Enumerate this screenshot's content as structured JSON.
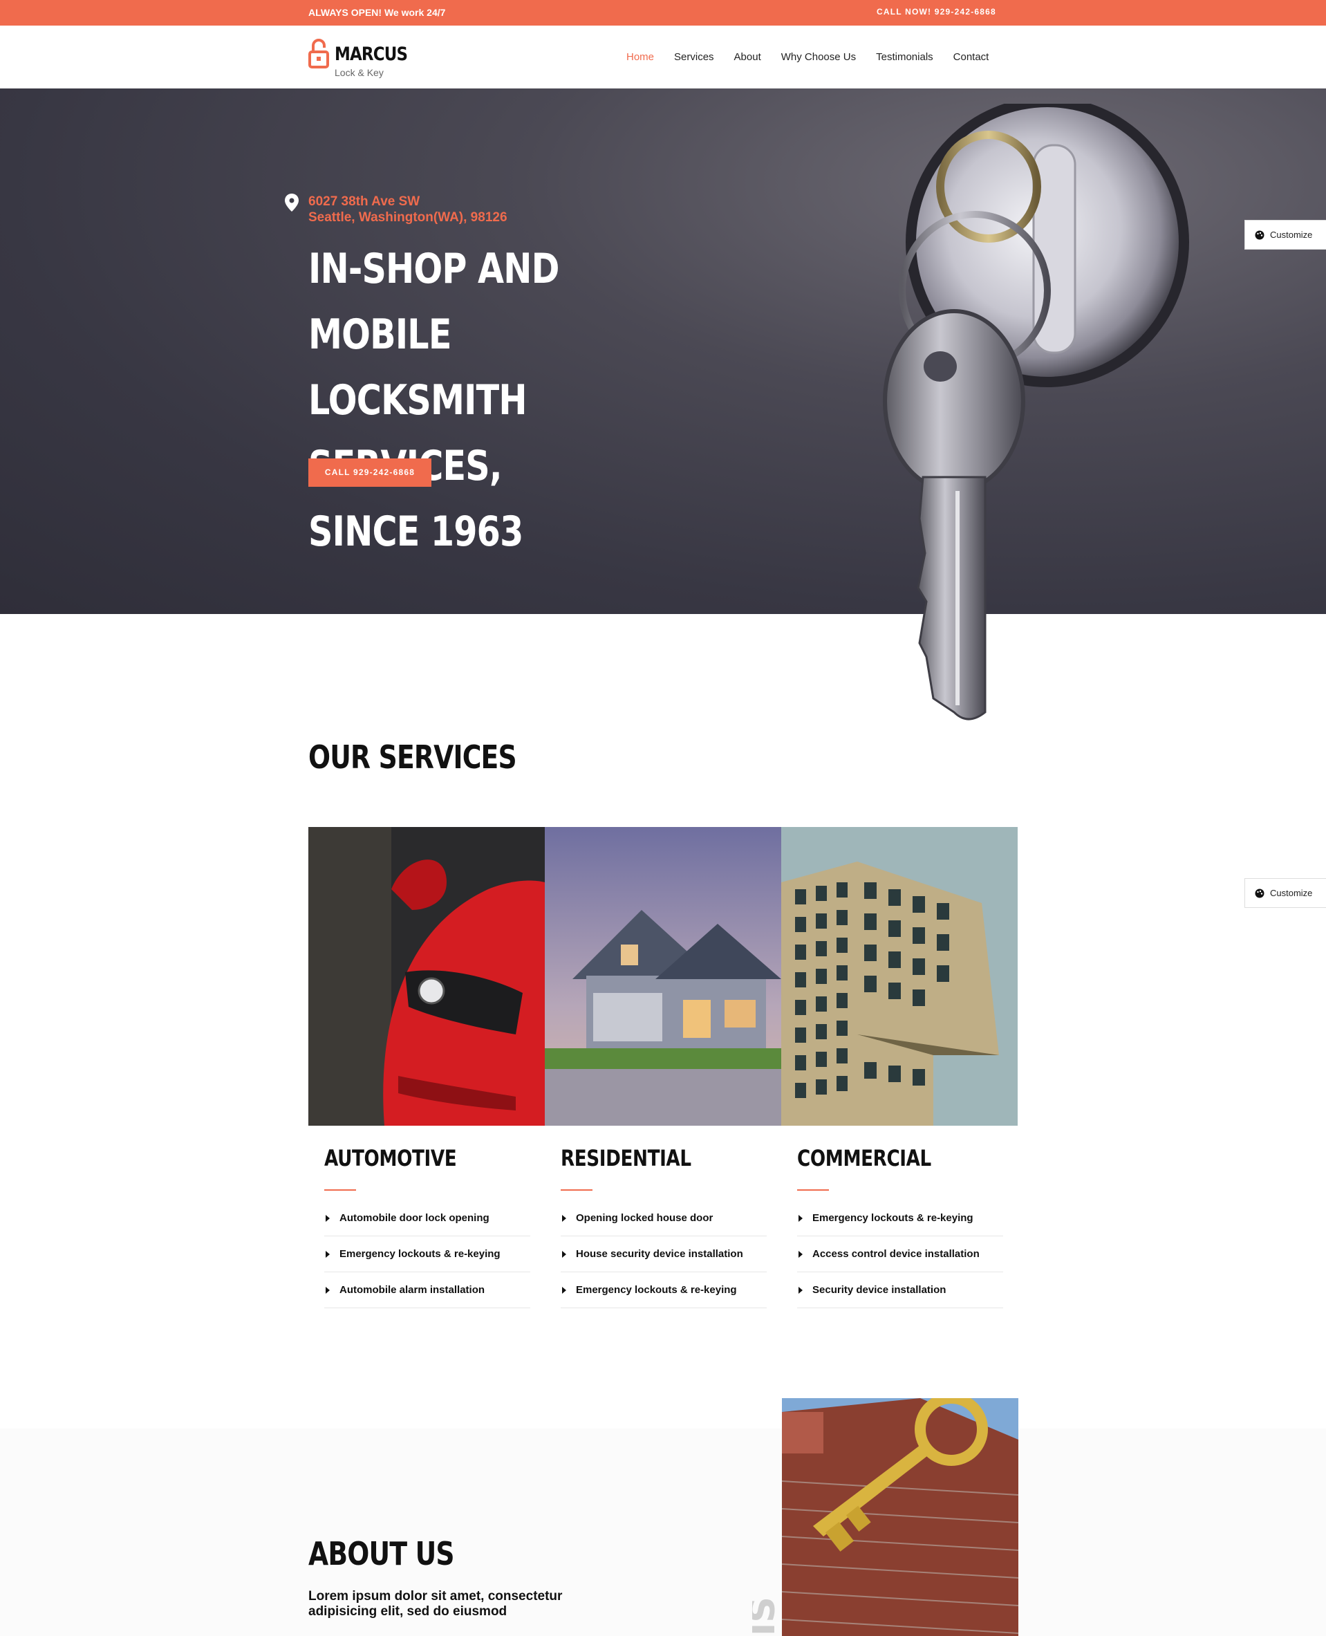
{
  "topbar": {
    "left_text": "ALWAYS OPEN! We work 24/7",
    "right_text": "CALL NOW! 929-242-6868"
  },
  "logo": {
    "name": "MARCUS",
    "sub": "Lock & Key"
  },
  "nav": {
    "items": [
      "Home",
      "Services",
      "About",
      "Why Choose Us",
      "Testimonials",
      "Contact"
    ],
    "active": "Home"
  },
  "hero": {
    "address_line1": "6027 38th Ave SW",
    "address_line2": "Seattle, Washington(WA), 98126",
    "headline_line1": "IN-SHOP AND MOBILE",
    "headline_line2": "LOCKSMITH SERVICES,",
    "headline_line3": "SINCE 1963",
    "cta_label": "CALL 929-242-6868"
  },
  "customize_label": "Customize",
  "services": {
    "title": "OUR SERVICES",
    "columns": [
      {
        "title": "AUTOMOTIVE",
        "items": [
          "Automobile door lock opening",
          "Emergency lockouts & re-keying",
          "Automobile alarm installation"
        ]
      },
      {
        "title": "RESIDENTIAL",
        "items": [
          "Opening locked house door",
          "House security device installation",
          "Emergency lockouts & re-keying"
        ]
      },
      {
        "title": "COMMERCIAL",
        "items": [
          "Emergency lockouts & re-keying",
          "Access control device installation",
          "Security device installation"
        ]
      }
    ]
  },
  "about": {
    "title": "ABOUT US",
    "text": "Lorem ipsum dolor sit amet, consectetur adipisicing elit, sed do eiusmod"
  },
  "colors": {
    "accent": "#f06b4d",
    "hero_bg": "#383743",
    "text": "#111111"
  }
}
